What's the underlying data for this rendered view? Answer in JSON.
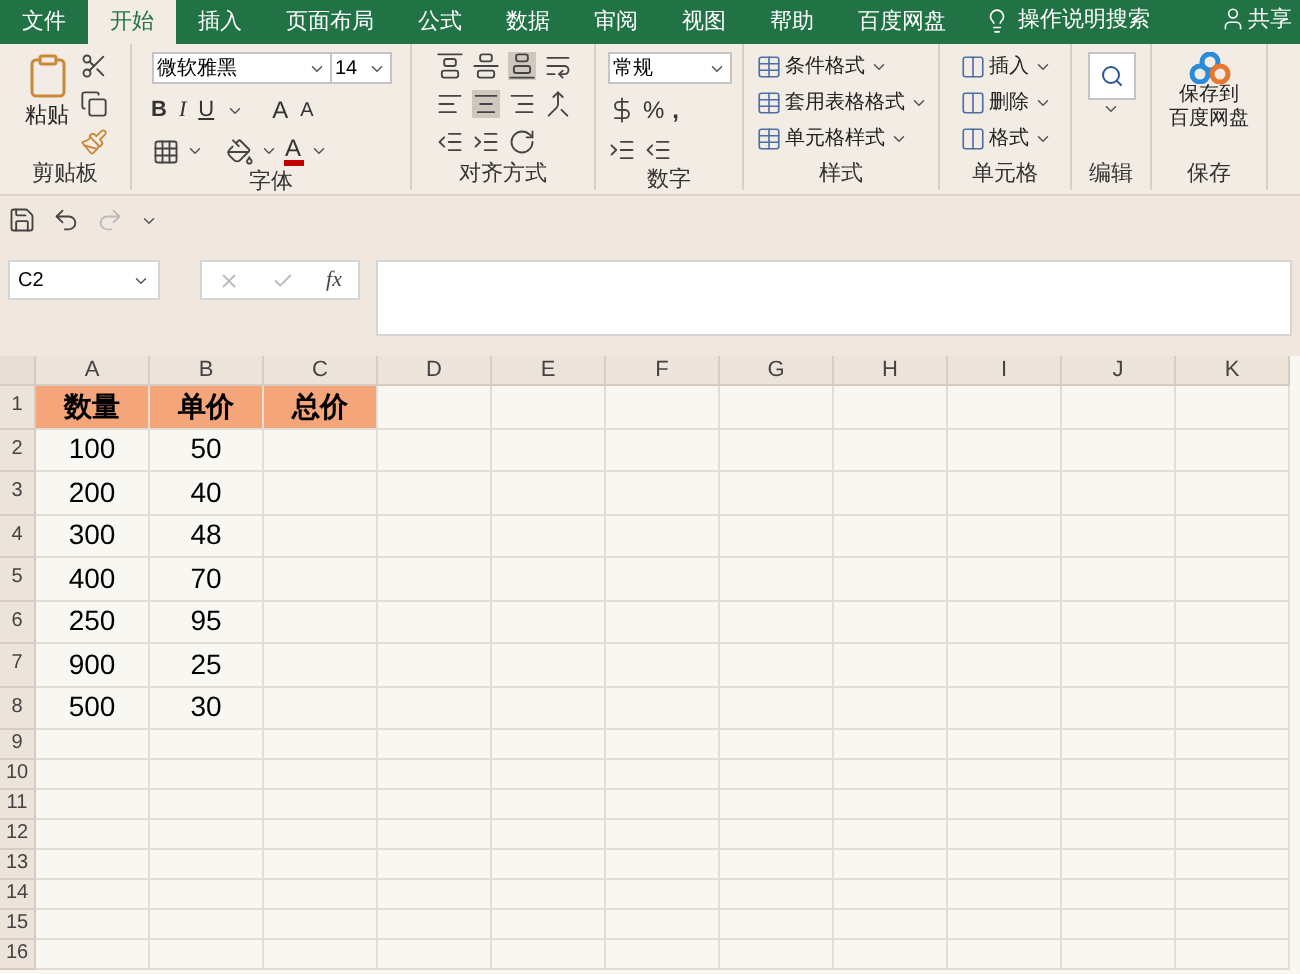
{
  "tabs": [
    {
      "label": "文件",
      "selected": false
    },
    {
      "label": "开始",
      "selected": true
    },
    {
      "label": "插入",
      "selected": false
    },
    {
      "label": "页面布局",
      "selected": false
    },
    {
      "label": "公式",
      "selected": false
    },
    {
      "label": "数据",
      "selected": false
    },
    {
      "label": "审阅",
      "selected": false
    },
    {
      "label": "视图",
      "selected": false
    },
    {
      "label": "帮助",
      "selected": false
    },
    {
      "label": "百度网盘",
      "selected": false
    }
  ],
  "tell_me": "操作说明搜索",
  "share": "共享",
  "ribbon": {
    "clipboard": {
      "paste": "粘贴",
      "label": "剪贴板"
    },
    "font": {
      "name": "微软雅黑",
      "size": "14",
      "bold": "B",
      "italic": "I",
      "underline": "U",
      "grow": "A",
      "shrink": "A",
      "color_letter": "A",
      "label": "字体"
    },
    "alignment": {
      "label": "对齐方式"
    },
    "number": {
      "format": "常规",
      "percent": "%",
      "comma": ",",
      "label": "数字"
    },
    "styles": {
      "items": [
        "条件格式",
        "套用表格格式",
        "单元格样式"
      ],
      "label": "样式"
    },
    "cells": {
      "items": [
        "插入",
        "删除",
        "格式"
      ],
      "label": "单元格"
    },
    "editing": {
      "label": "编辑"
    },
    "save": {
      "button": [
        "保存到",
        "百度网盘"
      ],
      "label": "保存"
    }
  },
  "name_box": "C2",
  "fx": "fx",
  "columns": [
    "A",
    "B",
    "C",
    "D",
    "E",
    "F",
    "G",
    "H",
    "I",
    "J",
    "K"
  ],
  "rows": [
    {
      "number": "1",
      "kind": "header",
      "cells": [
        "数量",
        "单价",
        "总价"
      ]
    },
    {
      "number": "2",
      "kind": "data",
      "cells": [
        "100",
        "50"
      ]
    },
    {
      "number": "3",
      "kind": "data",
      "cells": [
        "200",
        "40"
      ]
    },
    {
      "number": "4",
      "kind": "data",
      "cells": [
        "300",
        "48"
      ]
    },
    {
      "number": "5",
      "kind": "data",
      "cells": [
        "400",
        "70"
      ]
    },
    {
      "number": "6",
      "kind": "data",
      "cells": [
        "250",
        "95"
      ]
    },
    {
      "number": "7",
      "kind": "data",
      "cells": [
        "900",
        "25"
      ]
    },
    {
      "number": "8",
      "kind": "data",
      "cells": [
        "500",
        "30"
      ]
    },
    {
      "number": "9",
      "kind": "blank",
      "cells": []
    },
    {
      "number": "10",
      "kind": "blank",
      "cells": []
    },
    {
      "number": "11",
      "kind": "blank",
      "cells": []
    },
    {
      "number": "12",
      "kind": "blank",
      "cells": []
    },
    {
      "number": "13",
      "kind": "blank",
      "cells": []
    },
    {
      "number": "14",
      "kind": "blank",
      "cells": []
    },
    {
      "number": "15",
      "kind": "blank",
      "cells": []
    },
    {
      "number": "16",
      "kind": "blank",
      "cells": []
    }
  ]
}
